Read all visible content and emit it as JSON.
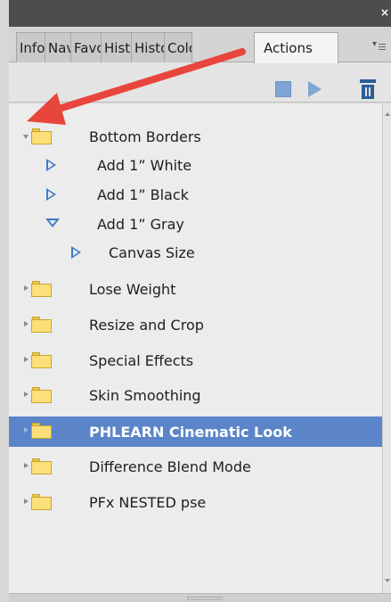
{
  "panel": {
    "close_glyph": "×",
    "menu_glyph": "▾",
    "tabs": [
      "Info",
      "Navigator",
      "Favorites",
      "History",
      "Histogram",
      "Color",
      "Actions"
    ],
    "active_tab": "Actions"
  },
  "toolbar": {
    "stop_icon": "stop-icon",
    "play_icon": "play-icon",
    "delete_icon": "trash-icon"
  },
  "actions": {
    "sets": [
      {
        "name": "Bottom Borders",
        "expanded": true,
        "actions": [
          {
            "name": "Add 1” White",
            "expanded": false
          },
          {
            "name": "Add 1” Black",
            "expanded": false
          },
          {
            "name": "Add 1” Gray",
            "expanded": true,
            "steps": [
              "Canvas Size"
            ]
          }
        ]
      },
      {
        "name": "Lose Weight",
        "expanded": false
      },
      {
        "name": "Resize and Crop",
        "expanded": false
      },
      {
        "name": "Special Effects",
        "expanded": false
      },
      {
        "name": "Skin Smoothing",
        "expanded": false
      },
      {
        "name": "PHLEARN Cinematic Look",
        "expanded": false,
        "selected": true
      },
      {
        "name": "Difference Blend Mode",
        "expanded": false
      },
      {
        "name": "PFx NESTED pse",
        "expanded": false
      }
    ]
  },
  "colors": {
    "selection": "#5b85c8",
    "annotation_arrow": "#e8453c",
    "folder": "#fbe07a",
    "action_triangle": "#3f79c7"
  }
}
